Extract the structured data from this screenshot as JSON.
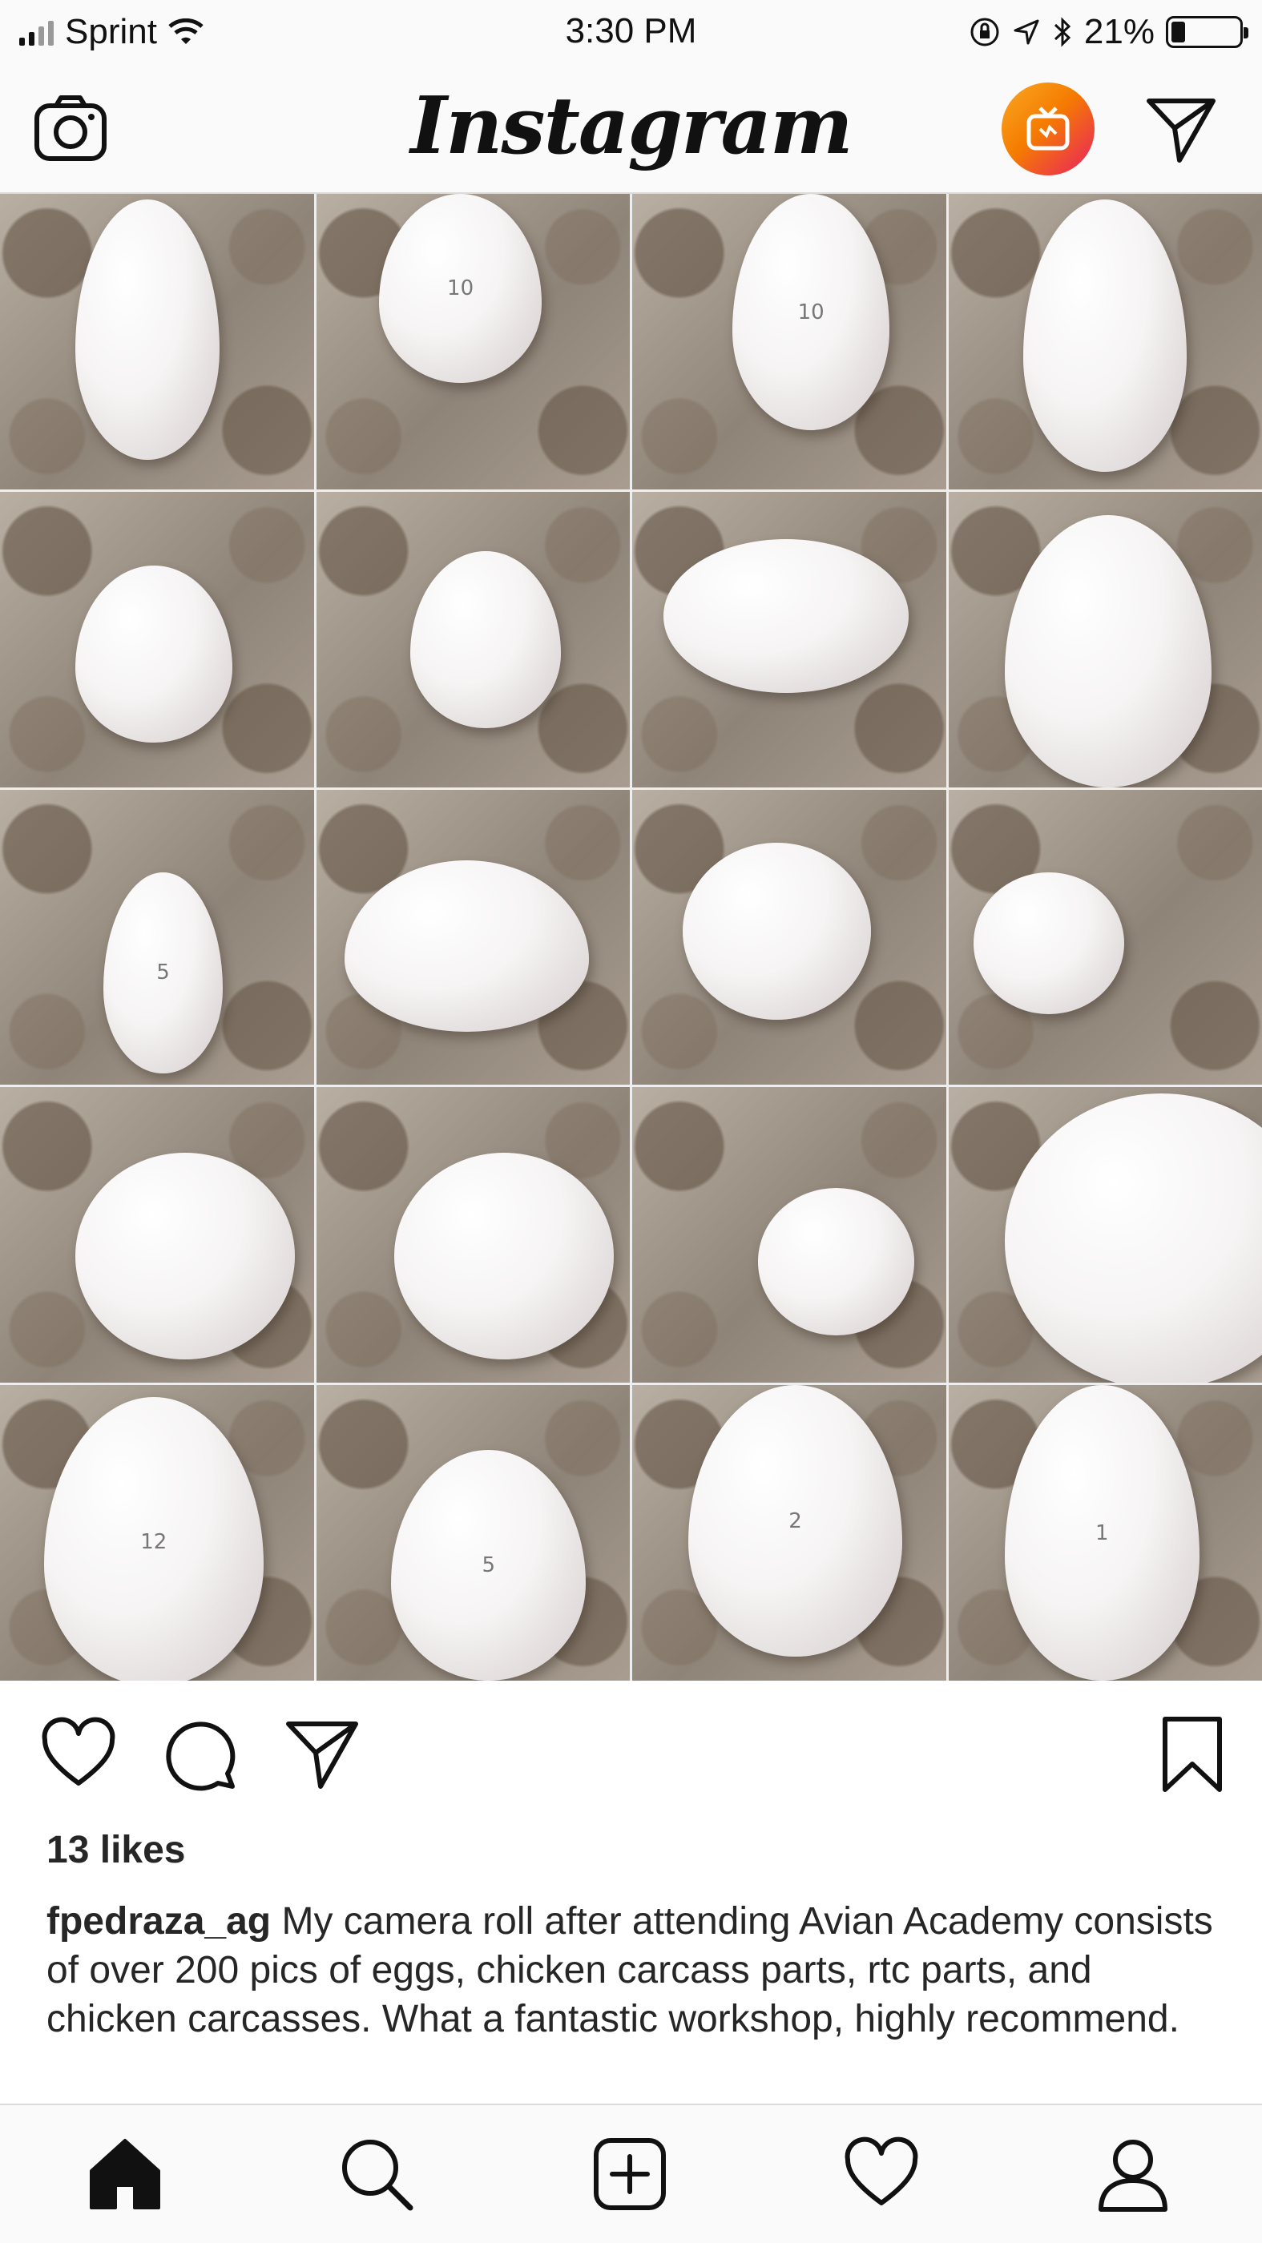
{
  "status_bar": {
    "carrier": "Sprint",
    "time": "3:30 PM",
    "battery_percent": "21%",
    "battery_level": 0.21
  },
  "header": {
    "logo_text": "Instagram",
    "left_icon": "camera-icon",
    "right_icons": [
      "igtv-icon",
      "direct-message-icon"
    ],
    "igtv_colors": [
      "#f9a825",
      "#f57c00",
      "#e91e63"
    ]
  },
  "post": {
    "images": [
      {
        "label": ""
      },
      {
        "label": "10"
      },
      {
        "label": "10"
      },
      {
        "label": ""
      },
      {
        "label": ""
      },
      {
        "label": ""
      },
      {
        "label": ""
      },
      {
        "label": ""
      },
      {
        "label": "5"
      },
      {
        "label": ""
      },
      {
        "label": ""
      },
      {
        "label": ""
      },
      {
        "label": ""
      },
      {
        "label": ""
      },
      {
        "label": ""
      },
      {
        "label": ""
      },
      {
        "label": "12"
      },
      {
        "label": "5"
      },
      {
        "label": "2"
      },
      {
        "label": "1"
      }
    ],
    "actions": [
      "heart-icon",
      "comment-icon",
      "share-icon",
      "bookmark-icon"
    ],
    "likes": "13 likes",
    "username": "fpedraza_ag",
    "caption": "My camera roll after attending Avian Academy consists of over 200 pics of eggs, chicken carcass parts, rtc parts, and chicken carcasses. What a fantastic workshop, highly recommend."
  },
  "tab_bar": {
    "tabs": [
      "home-icon",
      "search-icon",
      "new-post-icon",
      "activity-icon",
      "profile-icon"
    ],
    "active": "home-icon"
  }
}
